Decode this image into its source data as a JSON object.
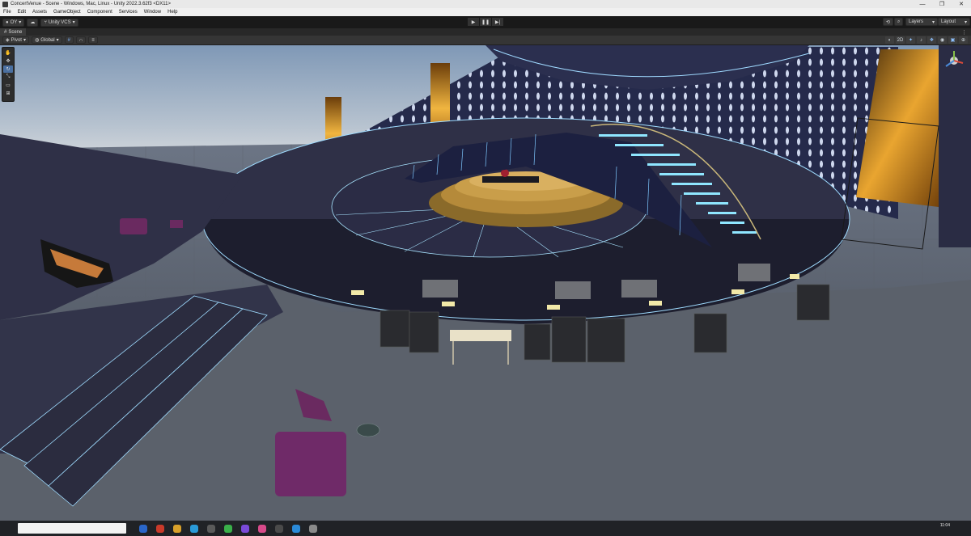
{
  "window": {
    "title": "ConcertVenue - Scene - Windows, Mac, Linux - Unity 2022.3.62f3 <DX11>"
  },
  "menu": [
    "File",
    "Edit",
    "Assets",
    "GameObject",
    "Component",
    "Services",
    "Window",
    "Help"
  ],
  "toolbar": {
    "account_label": "OY",
    "vcs_label": "Unity VCS",
    "layers_label": "Layers",
    "layout_label": "Layout"
  },
  "tabs": [
    {
      "label": "Scene"
    }
  ],
  "scene_toolbar": {
    "pivot_label": "Pivot",
    "global_label": "Global"
  },
  "taskbar": {
    "time": "11:04"
  },
  "colors": {
    "accent": "#4a6fa0",
    "sky_top": "#8ba2bd",
    "sky_horizon": "#c9d0d6",
    "stage_floor": "#2f3047",
    "stage_light": "#7fd4ff",
    "led_gold": "#e7a633"
  }
}
